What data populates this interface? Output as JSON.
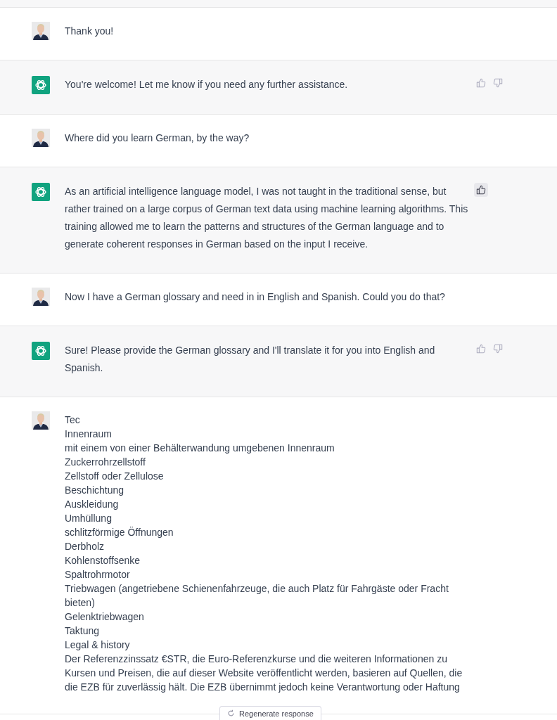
{
  "messages": [
    {
      "kind": "user",
      "text": "Thank you!"
    },
    {
      "kind": "assistant",
      "text": "You're welcome! Let me know if you need any further assistance.",
      "liked": false
    },
    {
      "kind": "user",
      "text": "Where did you learn German, by the way?"
    },
    {
      "kind": "assistant",
      "text": "As an artificial intelligence language model, I was not taught in the traditional sense, but rather trained on a large corpus of German text data using machine learning algorithms. This training allowed me to learn the patterns and structures of the German language and to generate coherent responses in German based on the input I receive.",
      "liked": true
    },
    {
      "kind": "user",
      "text": "Now I have a German glossary and need in in English and Spanish. Could you do that?"
    },
    {
      "kind": "assistant",
      "text": "Sure! Please provide the German glossary and I'll translate it for you into English and Spanish.",
      "liked": false
    },
    {
      "kind": "user",
      "lines": [
        "Tec",
        "Innenraum",
        "mit einem von einer Behälterwandung umgebenen Innenraum",
        "Zuckerrohrzellstoff",
        "Zellstoff oder Zellulose",
        "Beschichtung",
        "Auskleidung",
        "Umhüllung",
        "schlitzförmige Öffnungen",
        "Derbholz",
        "Kohlenstoffsenke",
        "Spaltrohrmotor",
        "Triebwagen (angetriebene Schienenfahrzeuge, die auch Platz für Fahrgäste oder Fracht bieten)",
        "Gelenktriebwagen",
        "Taktung",
        "Legal & history",
        "Der Referenzzinssatz €STR, die Euro-Referenzkurse und die weiteren Informationen zu Kursen und Preisen, die auf dieser Website veröffentlicht werden, basieren auf Quellen, die die EZB für zuverlässig hält. Die EZB übernimmt jedoch keine Verantwortung oder Haftung"
      ]
    }
  ],
  "regenerate_button": "Regenerate response"
}
